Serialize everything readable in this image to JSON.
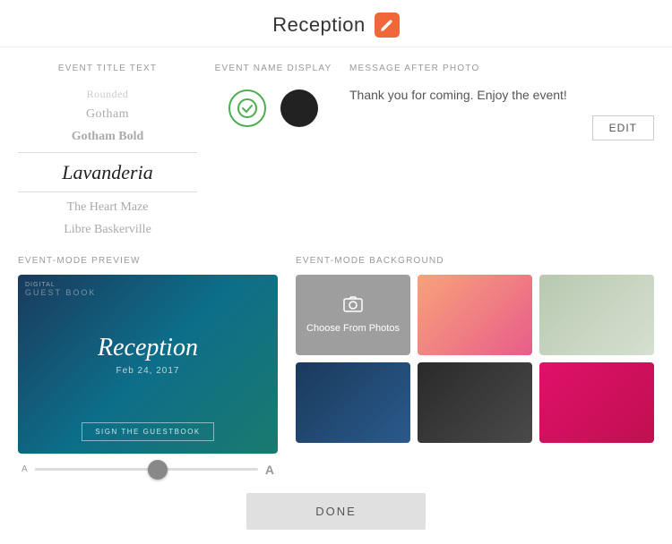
{
  "header": {
    "title": "Reception",
    "edit_icon_alt": "edit"
  },
  "event_title_text": {
    "label": "EVENT TITLE TEXT",
    "fonts": [
      {
        "name": "Rounded",
        "display": "Rounded",
        "class": "font-gotham"
      },
      {
        "name": "Gotham",
        "display": "Gotham",
        "class": "font-gotham"
      },
      {
        "name": "Gotham Bold",
        "display": "Gotham Bold",
        "class": "font-gotham-bold"
      },
      {
        "name": "Lavanderia",
        "display": "Lavanderia",
        "class": "font-lavanderia",
        "selected": true
      },
      {
        "name": "The Heart Maze",
        "display": "The Heart Maze",
        "class": "font-heart-maze"
      },
      {
        "name": "Libre Baskerville",
        "display": "Libre Baskerville",
        "class": "font-libre"
      }
    ]
  },
  "event_name_display": {
    "label": "EVENT NAME DISPLAY",
    "toggle_on": true
  },
  "message_after_photo": {
    "label": "MESSAGE AFTER PHOTO",
    "text": "Thank you for coming. Enjoy the event!",
    "edit_button": "EDIT"
  },
  "preview": {
    "label": "EVENT-MODE PREVIEW",
    "top_label": "DIGITAL",
    "logo": "GUEST BOOK",
    "title": "Reception",
    "date": "Feb 24, 2017",
    "cta": "SIGN THE GUESTBOOK"
  },
  "slider": {
    "left_label": "A",
    "right_label": "A",
    "value": 55
  },
  "background": {
    "label": "EVENT-MODE BACKGROUND",
    "choose_photos_label": "Choose From Photos",
    "items": [
      {
        "id": "photos",
        "type": "photos"
      },
      {
        "id": "gradient-pink",
        "type": "gradient"
      },
      {
        "id": "gradient-sage",
        "type": "gradient"
      },
      {
        "id": "gradient-navy",
        "type": "gradient"
      },
      {
        "id": "gradient-dark",
        "type": "gradient"
      },
      {
        "id": "gradient-magenta",
        "type": "gradient"
      }
    ]
  },
  "done_button": "DONE"
}
